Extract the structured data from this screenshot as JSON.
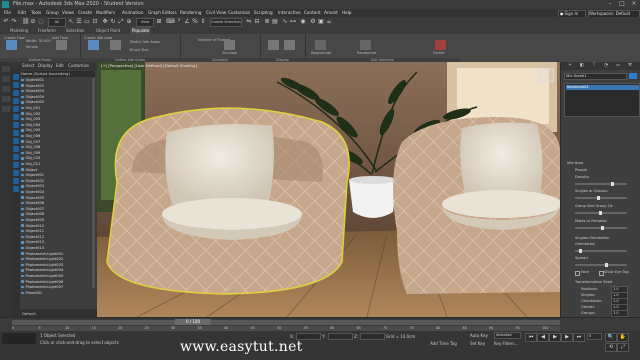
{
  "app": {
    "title": "File.max - Autodesk 3ds Max 2020 - Student Version",
    "menu": [
      "File",
      "Edit",
      "Tools",
      "Group",
      "Views",
      "Create",
      "Modifiers",
      "Animation",
      "Graph Editors",
      "Rendering",
      "Civil View",
      "Customize",
      "Scripting",
      "Interactive",
      "Content",
      "Arnold",
      "Help"
    ],
    "sign_in": "Sign In",
    "workspace_label": "Workspaces:",
    "workspace_value": "Default"
  },
  "ribbon": {
    "tabs": [
      "Modeling",
      "Freeform",
      "Selection",
      "Object Paint",
      "Populate"
    ],
    "active_tab": "Populate",
    "panels": [
      {
        "title": "Define Flows",
        "items": [
          "Create Flow",
          "Width: 30.000",
          "Simple",
          "Add Flow"
        ]
      },
      {
        "title": "Define Idle Areas",
        "items": [
          "Create Idle Area",
          "Modify Idle Areas",
          "Brush Size"
        ]
      },
      {
        "title": "Simulate",
        "items": [
          "Number of Frames",
          "Simulate"
        ]
      },
      {
        "title": "Display",
        "items": [
          "Display",
          "Show"
        ]
      },
      {
        "title": "Edit Selected",
        "items": [
          "Regenerate",
          "Randomize",
          "Delete"
        ]
      }
    ]
  },
  "scene_explorer": {
    "tabs": [
      "Select",
      "Display",
      "Edit",
      "Customize"
    ],
    "column_header": "Name (Sorted Ascending)",
    "items": [
      "Object001",
      "Object002",
      "Object003",
      "Object004",
      "Object005",
      "Obj_001",
      "Obj_002",
      "Obj_003",
      "Obj_004",
      "Obj_005",
      "Obj_006",
      "Obj_007",
      "Obj_008",
      "Obj_009",
      "Obj_010",
      "Obj_011",
      "Object",
      "Object001",
      "Object002",
      "Object003",
      "Object004",
      "Object005",
      "Object006",
      "Object007",
      "Object008",
      "Object009",
      "Object010",
      "Object011",
      "Object012",
      "Object013",
      "Object014",
      "PhotometricLight001",
      "PhotometricLight002",
      "PhotometricLight003",
      "PhotometricLight004",
      "PhotometricLight005",
      "PhotometricLight006",
      "PhotometricLight007",
      "Plane001"
    ],
    "footer": "Default"
  },
  "viewport": {
    "label": "[+] [Perspective] [User Defined] [Default Shading]"
  },
  "command_panel": {
    "object_name": "Idle Area01",
    "selected_item": "IdleArea001",
    "rollout_title": "Idle Area",
    "section_people": "People",
    "people_fields": [
      {
        "label": "Density:"
      },
      {
        "label": "Singles or Groups:"
      },
      {
        "label": "Group Size Group 1b:"
      },
      {
        "label": "Males or Females:"
      }
    ],
    "section_orientation": "Singles Orientation",
    "orientation": "Orientation",
    "spread": "Spread",
    "face_label": "Face",
    "checkbox_label": "Show Eye Tag",
    "section_transform": "Transformation Seed",
    "seed_fields": [
      {
        "label": "Positions:",
        "value": "1.0"
      },
      {
        "label": "Singles:",
        "value": "1.0"
      },
      {
        "label": "Orientation:",
        "value": "1.0"
      },
      {
        "label": "Gender:",
        "value": "1.0"
      },
      {
        "label": "Groups:",
        "value": "1.0"
      }
    ]
  },
  "timeline": {
    "frame_indicator": "0 / 100",
    "ticks": [
      "0",
      "5",
      "10",
      "15",
      "20",
      "25",
      "30",
      "35",
      "40",
      "45",
      "50",
      "55",
      "60",
      "65",
      "70",
      "75",
      "80",
      "85",
      "90",
      "95",
      "100"
    ]
  },
  "status": {
    "selected": "1 Object Selected",
    "prompt": "Click or click-and-drag to select objects",
    "x_label": "X:",
    "y_label": "Y:",
    "z_label": "Z:",
    "grid": "Grid = 10.0cm",
    "add_time_tag": "Add Time Tag",
    "auto_key": "Auto Key",
    "set_key": "Set Key",
    "selected_dropdown": "Selected",
    "key_filters": "Key Filters...",
    "frame": "0"
  },
  "watermark": "www.easytut.net",
  "colors": {
    "ui_dark": "#333333",
    "ui_mid": "#474747",
    "accent_blue": "#1f5f9c",
    "selection_yellow": "#e0d23a",
    "fabric": "#c8a98e",
    "floor": "#7a5a3a"
  }
}
